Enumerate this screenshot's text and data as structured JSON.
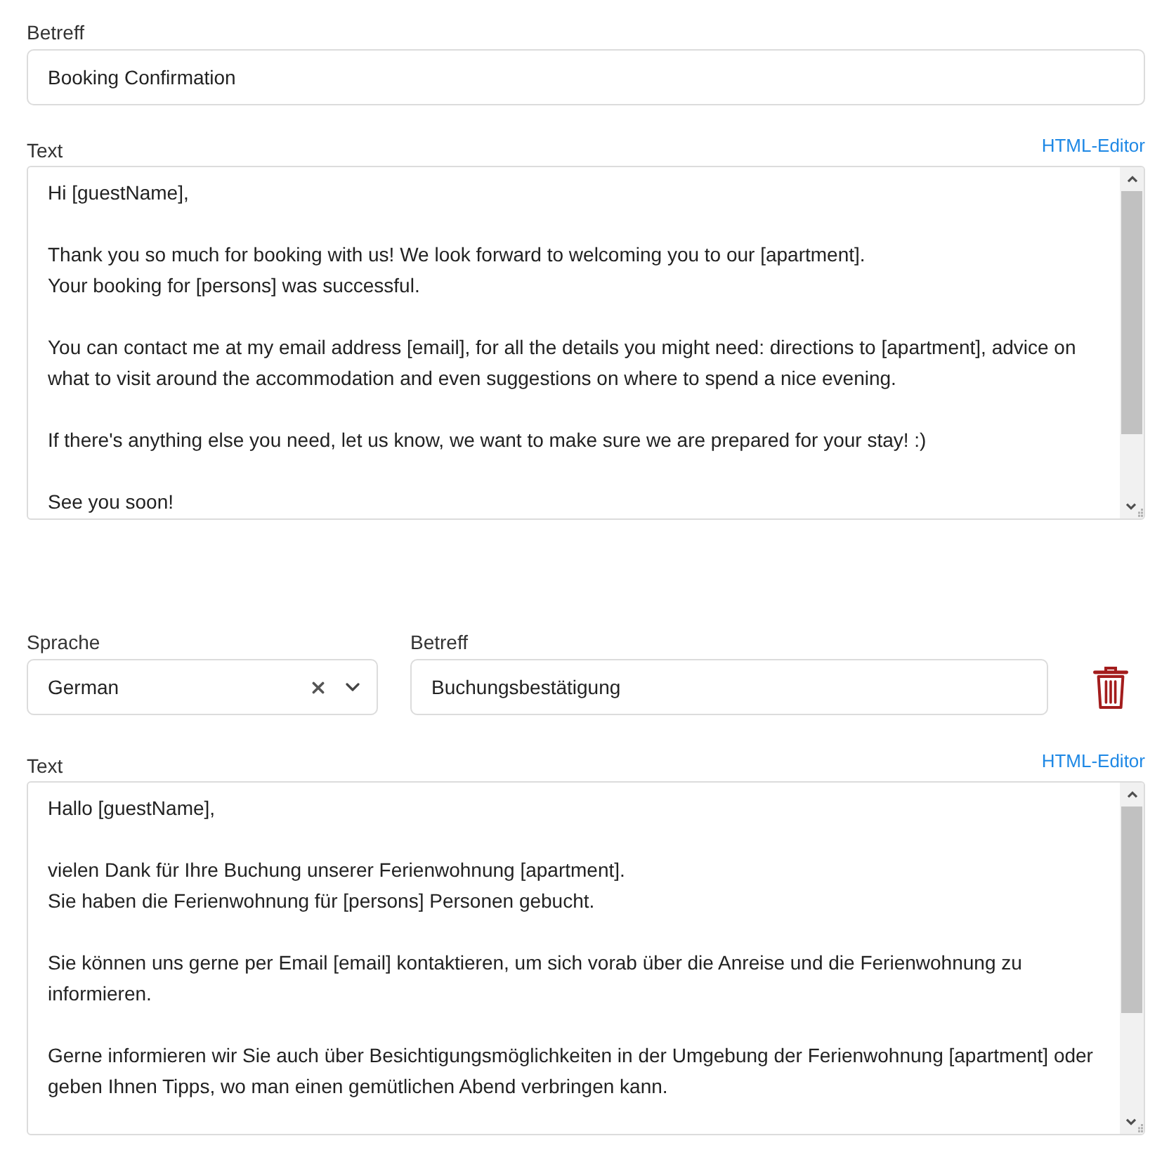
{
  "templates": [
    {
      "deletable": false,
      "subject": {
        "label": "Betreff",
        "value": "Booking Confirmation"
      },
      "text": {
        "label": "Text",
        "editor_link": "HTML-Editor",
        "paragraphs": [
          [
            "Hi [guestName],"
          ],
          [
            "Thank you so much for booking with us! We look forward to welcoming you to our [apartment].",
            "Your booking for [persons] was successful."
          ],
          [
            "You can contact me at my email address [email], for all the details you might need: directions to [apartment], advice on what to visit around the accommodation and even suggestions on where to spend a nice evening."
          ],
          [
            "If there's anything else you need, let us know, we want to make sure we are prepared for your stay! :)"
          ],
          [
            "See you soon!"
          ]
        ]
      }
    },
    {
      "deletable": true,
      "language": {
        "label": "Sprache",
        "value": "German"
      },
      "subject": {
        "label": "Betreff",
        "value": "Buchungsbestätigung"
      },
      "text": {
        "label": "Text",
        "editor_link": "HTML-Editor",
        "paragraphs": [
          [
            "Hallo [guestName],"
          ],
          [
            "vielen Dank für Ihre Buchung unserer Ferienwohnung [apartment].",
            "Sie haben die Ferienwohnung für [persons] Personen gebucht."
          ],
          [
            "Sie können uns gerne per Email [email] kontaktieren, um sich vorab über die Anreise und die Ferienwohnung zu informieren."
          ],
          [
            "Gerne informieren wir Sie auch über Besichtigungsmöglichkeiten in der Umgebung der Ferienwohnung [apartment] oder geben Ihnen Tipps, wo man einen gemütlichen Abend verbringen kann."
          ]
        ]
      }
    }
  ]
}
